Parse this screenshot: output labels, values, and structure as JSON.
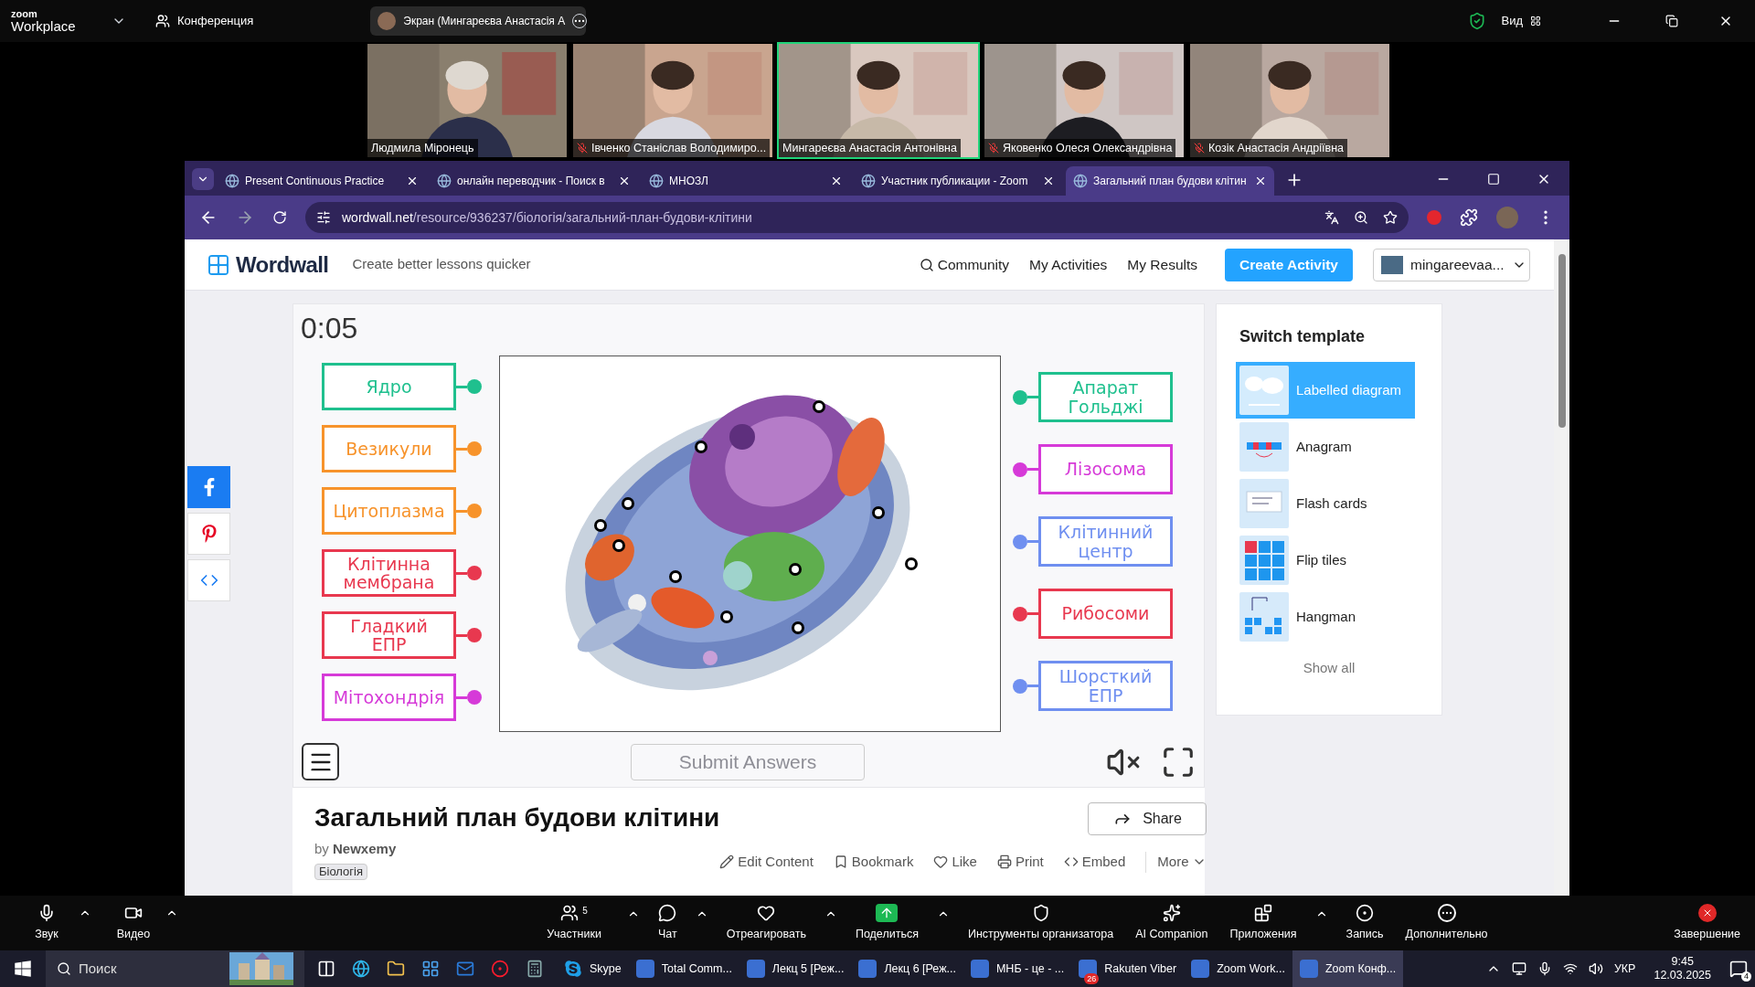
{
  "zoom_top": {
    "logo": "zoom",
    "logo_sub": "Workplace",
    "meeting_menu": "Конференция",
    "share_pill": "Экран (Мингареєва Анастасія А",
    "view": "Вид"
  },
  "participants": [
    {
      "name": "Людмила Міронець",
      "muted": false,
      "selected": false
    },
    {
      "name": "Івченко Станіслав Володимиро...",
      "muted": true,
      "selected": false
    },
    {
      "name": "Мингареєва Анастасія Антонівна",
      "muted": false,
      "selected": true
    },
    {
      "name": "Яковенко Олеся Олександрівна",
      "muted": true,
      "selected": false
    },
    {
      "name": "Козік Анастасія Андріївна",
      "muted": true,
      "selected": false
    }
  ],
  "browser": {
    "tabs": [
      {
        "title": "Present Continuous Practice",
        "selected": false
      },
      {
        "title": "онлайн переводчик - Поиск в",
        "selected": false
      },
      {
        "title": "МНОЗЛ",
        "selected": false
      },
      {
        "title": "Участник публикации - Zoom",
        "selected": false
      },
      {
        "title": "Загальний план будови клітин",
        "selected": true
      }
    ],
    "url_host": "wordwall.net",
    "url_path": "/resource/936237/біологія/загальний-план-будови-клітини"
  },
  "page": {
    "header": {
      "logo": "Wordwall",
      "tagline": "Create better lessons quicker",
      "nav": [
        "Community",
        "My Activities",
        "My Results"
      ],
      "create_button": "Create Activity",
      "user": "mingareevaa..."
    },
    "game": {
      "timer": "0:05",
      "left_labels": [
        {
          "text": "Ядро",
          "color": "#1fc08e"
        },
        {
          "text": "Везикули",
          "color": "#f7932b"
        },
        {
          "text": "Цитоплазма",
          "color": "#f7932b"
        },
        {
          "text": "Клітинна мембрана",
          "color": "#e8384f"
        },
        {
          "text": "Гладкий ЕПР",
          "color": "#e8384f"
        },
        {
          "text": "Мітохондрія",
          "color": "#d63ad8"
        }
      ],
      "right_labels": [
        {
          "text": "Апарат Гольджі",
          "color": "#1fc08e"
        },
        {
          "text": "Лізосома",
          "color": "#d63ad8"
        },
        {
          "text": "Клітинний центр",
          "color": "#6f8ff0"
        },
        {
          "text": "Рибосоми",
          "color": "#e8384f"
        },
        {
          "text": "Шорсткий ЕПР",
          "color": "#6f8ff0"
        }
      ],
      "submit": {
        "label": "Submit Answers",
        "disabled": true
      }
    },
    "templates": {
      "title": "Switch template",
      "items": [
        {
          "label": "Labelled diagram",
          "selected": true
        },
        {
          "label": "Anagram",
          "selected": false
        },
        {
          "label": "Flash cards",
          "selected": false
        },
        {
          "label": "Flip tiles",
          "selected": false
        },
        {
          "label": "Hangman",
          "selected": false
        }
      ],
      "show_all": "Show all"
    },
    "activity": {
      "title": "Загальний план будови клітини",
      "by": "by",
      "author": "Newxemy",
      "tag": "Біологія",
      "share": "Share",
      "actions": [
        "Edit Content",
        "Bookmark",
        "Like",
        "Print",
        "Embed"
      ],
      "more": "More"
    }
  },
  "zoom_toolbar": {
    "left": [
      "Звук",
      "Видео"
    ],
    "participants": {
      "label": "Участники",
      "count": "5"
    },
    "center": [
      "Чат",
      "Отреагировать",
      "Поделиться",
      "Инструменты организатора",
      "AI Companion",
      "Приложения",
      "Запись",
      "Дополнительно"
    ],
    "end": "Завершение"
  },
  "taskbar": {
    "search": "Поиск",
    "apps": [
      {
        "label": "Skype"
      },
      {
        "label": "Total Comm..."
      },
      {
        "label": "Лекц 5 [Реж..."
      },
      {
        "label": "Лекц 6 [Реж..."
      },
      {
        "label": "МНБ - це - ..."
      },
      {
        "label": "Rakuten Viber",
        "badge": "26"
      },
      {
        "label": "Zoom Work..."
      },
      {
        "label": "Zoom Конф..."
      }
    ],
    "lang": "УКР",
    "time": "9:45",
    "date": "12.03.2025",
    "notifications": "4"
  }
}
